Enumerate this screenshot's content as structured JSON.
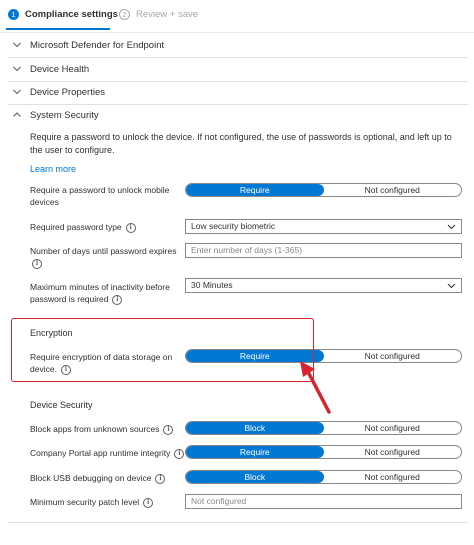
{
  "wizard": {
    "steps": [
      {
        "number": "1",
        "label": "Compliance settings",
        "active": true
      },
      {
        "number": "2",
        "label": "Review + save",
        "active": false
      }
    ]
  },
  "sections": {
    "defender": "Microsoft Defender for Endpoint",
    "health": "Device Health",
    "properties": "Device Properties",
    "system_security": "System Security"
  },
  "system_security": {
    "description": "Require a password to unlock the device. If not configured, the use of passwords is optional, and left up to the user to configure.",
    "learn_more": "Learn more",
    "require_password": {
      "label": "Require a password to unlock mobile devices",
      "options": [
        "Require",
        "Not configured"
      ],
      "selected": "Require"
    },
    "password_type": {
      "label": "Required password type",
      "value": "Low security biometric"
    },
    "expiration": {
      "label": "Number of days until password expires",
      "placeholder": "Enter number of days (1-365)"
    },
    "inactivity": {
      "label": "Maximum minutes of inactivity before password is required",
      "value": "30 Minutes"
    }
  },
  "encryption": {
    "heading": "Encryption",
    "require_encryption": {
      "label": "Require encryption of data storage on device.",
      "options": [
        "Require",
        "Not configured"
      ],
      "selected": "Require"
    }
  },
  "device_security": {
    "heading": "Device Security",
    "block_unknown": {
      "label": "Block apps from unknown sources",
      "options": [
        "Block",
        "Not configured"
      ],
      "selected": "Block"
    },
    "portal_integrity": {
      "label": "Company Portal app runtime integrity",
      "options": [
        "Require",
        "Not configured"
      ],
      "selected": "Require"
    },
    "usb_debugging": {
      "label": "Block USB debugging on device",
      "options": [
        "Block",
        "Not configured"
      ],
      "selected": "Block"
    },
    "patch_level": {
      "label": "Minimum security patch level",
      "placeholder": "Not configured"
    }
  },
  "icons": {
    "info": "i",
    "expand": "chevron-down-icon",
    "collapse": "chevron-up-icon"
  },
  "colors": {
    "accent": "#0078d4",
    "highlight": "#d9232e",
    "border": "#8a8886",
    "text": "#323130"
  }
}
